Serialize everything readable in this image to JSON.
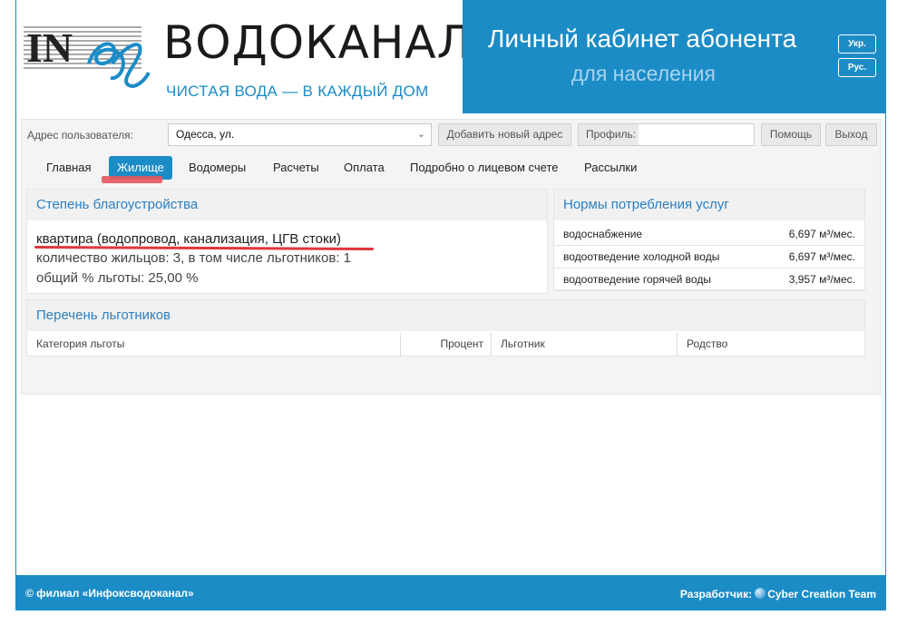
{
  "header": {
    "brand_name": "ВОДОКАНАЛ",
    "brand_slogan": "ЧИСТАЯ ВОДА — В КАЖДЫЙ ДОМ",
    "logo_letters": "IN",
    "banner_title": "Личный кабинет абонента",
    "banner_subtitle": "для населения",
    "lang_ukr": "Укр.",
    "lang_rus": "Рус.",
    "accent_color": "#1b8cc6"
  },
  "toolbar": {
    "address_label": "Адрес пользователя:",
    "address_value": "Одесса, ул.",
    "add_address_label": "Добавить новый адрес",
    "profile_label": "Профиль:",
    "help_label": "Помощь",
    "exit_label": "Выход"
  },
  "tabs": [
    {
      "label": "Главная",
      "active": false
    },
    {
      "label": "Жилище",
      "active": true
    },
    {
      "label": "Водомеры",
      "active": false
    },
    {
      "label": "Расчеты",
      "active": false
    },
    {
      "label": "Оплата",
      "active": false
    },
    {
      "label": "Подробно о лицевом счете",
      "active": false
    },
    {
      "label": "Рассылки",
      "active": false
    }
  ],
  "housing": {
    "title": "Степень благоустройства",
    "type": "квартира (водопровод, канализация, ЦГВ стоки)",
    "residents": "количество жильцов: 3, в том числе льготников: 1",
    "benefit_percent": "общий % льготы: 25,00 %"
  },
  "norms": {
    "title": "Нормы потребления услуг",
    "rows": [
      {
        "name": "водоснабжение",
        "value": "6,697 м³/мес."
      },
      {
        "name": "водоотведение холодной воды",
        "value": "6,697 м³/мес."
      },
      {
        "name": "водоотведение горячей воды",
        "value": "3,957 м³/мес."
      }
    ]
  },
  "beneficiaries": {
    "title": "Перечень льготников",
    "columns": [
      "Категория льготы",
      "Процент",
      "Льготник",
      "Родство"
    ]
  },
  "footer": {
    "copyright": "© филиал «Инфоксводоканал»",
    "developer_label": "Разработчик:",
    "developer_name": "Cyber Creation Team"
  }
}
